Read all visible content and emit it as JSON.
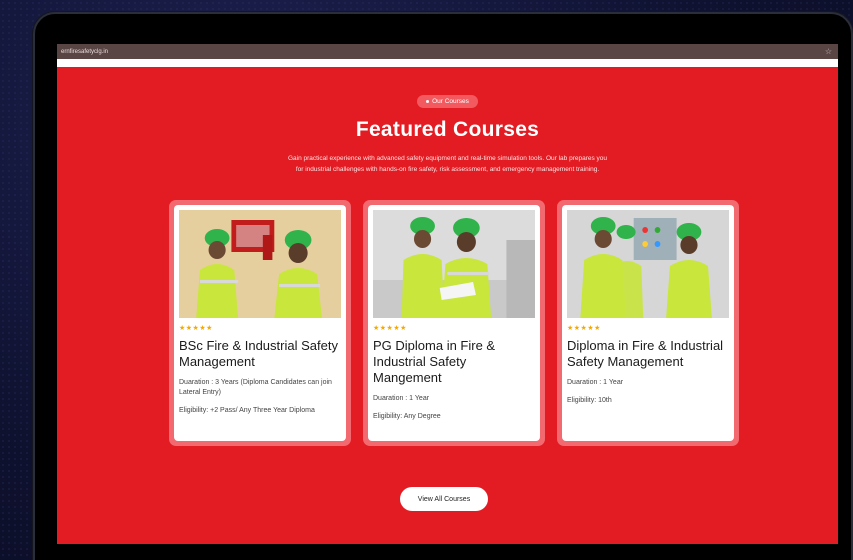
{
  "browser": {
    "url": "ernfiresafetyclg.in",
    "star": "☆"
  },
  "section": {
    "badge": "Our Courses",
    "title": "Featured Courses",
    "desc_line1": "Gain practical experience with advanced safety equipment and real-time simulation tools. Our lab prepares you",
    "desc_line2": "for industrial challenges with hands-on fire safety, risk assessment, and emergency management training."
  },
  "courses": [
    {
      "stars": "★★★★★",
      "title": "BSc Fire & Industrial Safety Management",
      "duration": "Duaration : 3 Years (Diploma Candidates can join Lateral Entry)",
      "eligibility": "Eligibility: +2 Pass/ Any Three Year Diploma"
    },
    {
      "stars": "★★★★★",
      "title": "PG Diploma in Fire & Industrial Safety Mangement",
      "duration": "Duaration : 1 Year",
      "eligibility": "Eligibility: Any Degree"
    },
    {
      "stars": "★★★★★",
      "title": "Diploma in Fire & Industrial Safety Management",
      "duration": "Duaration : 1 Year",
      "eligibility": "Eligibility: 10th"
    }
  ],
  "view_all": "View All Courses",
  "colors": {
    "brand_red": "#e31b23",
    "helmet_green": "#2fb34a",
    "vest": "#c8e63c",
    "star": "#f5a800"
  }
}
